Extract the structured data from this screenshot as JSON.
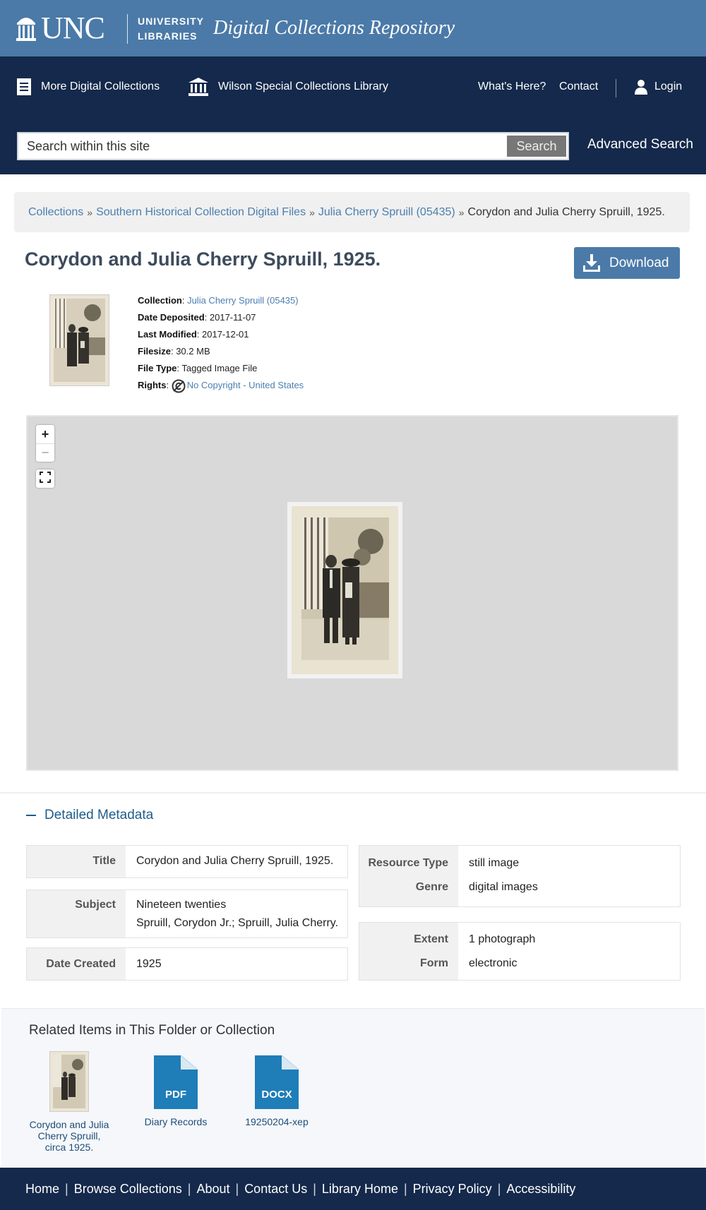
{
  "header": {
    "logo_text": "UNC",
    "libraries_line1": "UNIVERSITY",
    "libraries_line2": "LIBRARIES",
    "site_title": "Digital Collections Repository"
  },
  "nav": {
    "more_collections": "More Digital Collections",
    "wilson_library": "Wilson Special Collections Library",
    "whats_here": "What's Here?",
    "contact": "Contact",
    "login": "Login"
  },
  "search": {
    "placeholder": "Search within this site",
    "button": "Search",
    "advanced": "Advanced Search"
  },
  "breadcrumb": {
    "items": [
      "Collections",
      "Southern Historical Collection Digital Files",
      "Julia Cherry Spruill (05435)"
    ],
    "current": "Corydon and Julia Cherry Spruill, 1925.",
    "separator": "»"
  },
  "item": {
    "title": "Corydon and Julia Cherry Spruill, 1925.",
    "download_label": "Download",
    "summary": {
      "collection_label": "Collection",
      "collection_value": "Julia Cherry Spruill (05435)",
      "date_deposited_label": "Date Deposited",
      "date_deposited_value": "2017-11-07",
      "last_modified_label": "Last Modified",
      "last_modified_value": "2017-12-01",
      "filesize_label": "Filesize",
      "filesize_value": "30.2 MB",
      "filetype_label": "File Type",
      "filetype_value": "Tagged Image File",
      "rights_label": "Rights",
      "rights_link1": "No Copyright",
      "rights_dash": " - ",
      "rights_link2": "United States"
    }
  },
  "viewer": {
    "zoom_in": "+",
    "zoom_out": "−"
  },
  "detailed_metadata": {
    "toggle_label": "Detailed Metadata",
    "left": {
      "title_label": "Title",
      "title_value": "Corydon and Julia Cherry Spruill, 1925.",
      "subject_label": "Subject",
      "subject_values": [
        "Nineteen twenties",
        "Spruill, Corydon Jr.; Spruill, Julia Cherry."
      ],
      "date_created_label": "Date Created",
      "date_created_value": "1925"
    },
    "right": {
      "resource_type_label": "Resource Type",
      "resource_type_value": "still image",
      "genre_label": "Genre",
      "genre_value": "digital images",
      "extent_label": "Extent",
      "extent_value": "1 photograph",
      "form_label": "Form",
      "form_value": "electronic"
    }
  },
  "related": {
    "title": "Related Items in This Folder or Collection",
    "items": [
      {
        "caption_lines": [
          "Corydon and Julia",
          "Cherry Spruill,",
          "circa 1925."
        ],
        "kind": "image"
      },
      {
        "caption_lines": [
          "Diary Records"
        ],
        "kind": "file",
        "ext": "PDF"
      },
      {
        "caption_lines": [
          "19250204-xep"
        ],
        "kind": "file",
        "ext": "DOCX"
      }
    ]
  },
  "footer": {
    "links": [
      "Home",
      "Browse Collections",
      "About",
      "Contact Us",
      "Library Home",
      "Privacy Policy",
      "Accessibility"
    ],
    "separator": "|"
  },
  "colors": {
    "banner": "#4b7aa8",
    "navbar": "#14294b",
    "link": "#4b7fb0",
    "file_icon": "#1f7db8"
  },
  "icons": [
    "well-logo-icon",
    "document-list-icon",
    "library-building-icon",
    "user-icon",
    "download-icon",
    "no-copyright-icon",
    "fullscreen-icon"
  ]
}
